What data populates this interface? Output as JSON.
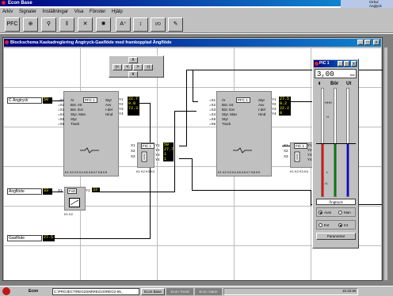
{
  "app": {
    "title": "Econ Base"
  },
  "corner_text": {
    "line1": "Cirkul",
    "line2": "Anglyck"
  },
  "menu": [
    "Arkiv",
    "Signaler",
    "Inställningar",
    "Visa",
    "Fönster",
    "Hjälp"
  ],
  "toolbar": [
    "PFC",
    "⊕",
    "⚲",
    "‖",
    "✕",
    "✺",
    "A⁺",
    "↕",
    "I/O",
    "✎"
  ],
  "window": {
    "title": "Blockschema Kaskadreglering Ångtryck-Gasflöde med framkopplad Ångflöde",
    "controls": [
      "_",
      "□",
      "X"
    ]
  },
  "nav": {
    "up": "∧",
    "down": "∨",
    "left": "<",
    "right": ">",
    "first": "|<",
    "last": ">|"
  },
  "inputs": {
    "angtryck": {
      "label": "C Ångtryck",
      "value": "50"
    },
    "angflode": {
      "label": "Ångflöde",
      "value": "33"
    },
    "gasflode": {
      "label": "Gasflöde",
      "value": "27.5"
    }
  },
  "pfc1": {
    "title": "PFC 1",
    "x_pins": [
      "X1",
      "X2",
      "X3",
      "X4",
      "X5"
    ],
    "x_names": [
      "Ár",
      "Bör. Int",
      "Bör. Ext",
      "Styr. Man",
      "Styr",
      "Track"
    ],
    "x_prefix": [
      "=X1",
      "=X2",
      "=X3",
      "=X4",
      "=X5",
      "=X6"
    ],
    "right_names": [
      "Styr",
      "Avv",
      "I-del",
      "Hind"
    ],
    "y_pins": [
      "Y1",
      "Y2",
      "Y3",
      "Y4"
    ],
    "y_values": [
      "22.7",
      "0.0",
      "72.3",
      ""
    ],
    "k_label": "K1 K2 K3 K4 K5 K6 K7 K8 K9"
  },
  "fic1_left": {
    "title": "FIC 1",
    "x_pins": [
      "X1",
      "X2",
      "X3"
    ],
    "y_pins": [
      "Y1",
      "Y2",
      "Y3",
      "Y4"
    ],
    "y_values": [
      "50",
      "27.7",
      "1",
      "1"
    ],
    "k_label": "K1 K2 K3 K4"
  },
  "pfc2": {
    "title": "PFC 1",
    "x_pins": [
      "X1",
      "X2",
      "X3",
      "X4",
      "X5"
    ],
    "x_names": [
      "Ár",
      "Bör. Int",
      "Bör. Ext",
      "Styr. Man",
      "Styr",
      "Track"
    ],
    "x_prefix": [
      "=X1",
      "=X2",
      "=X3",
      "=X4",
      "=X5",
      "=X6"
    ],
    "right_names": [
      "Styr",
      "Avv",
      "I-del",
      "Hind"
    ],
    "y_pins": [
      "Y1",
      "Y2",
      "Y3",
      "Y4"
    ],
    "y_values": [
      "27.5",
      "0.2",
      "22.2",
      "0"
    ],
    "k_label": "K1 K2 K3 K4 K5 K6 K7 K8 K9"
  },
  "fic1_right": {
    "title": "FIC 1",
    "x_pins": [
      "X1",
      "X2",
      "X3"
    ],
    "y_pins": [
      "Y1",
      "Y2",
      "Y3",
      "Y4"
    ],
    "k_label": "K1 K2 K3 K4"
  },
  "fxg": {
    "title": "FxG",
    "x_label": "X1",
    "y_label": "Y1",
    "y_value": "33",
    "k_label": "K1 K2"
  },
  "faceplate": {
    "title": "PIC 1",
    "controls": [
      "_",
      "□",
      "X"
    ],
    "value": "3,00",
    "unit": "bar",
    "col_bor": "Bör",
    "col_ut": "Ut",
    "scale_labels": [
      "HHH",
      "H",
      "L",
      "LL"
    ],
    "tag": "Ångtryck",
    "mode": {
      "auto": "Auto",
      "man": "Man"
    },
    "source": {
      "ext": "Ext",
      "int": "Int"
    },
    "param_button": "Parametrar",
    "colors": {
      "pv": "#ff0000",
      "sp": "#008000",
      "out": "#0000ff"
    }
  },
  "taskbar": {
    "start": "Econ",
    "path": "C:\\PROJECT\\REG2SIM\\REG2S\\REG2-55_",
    "tasks": [
      "Econ Base",
      "Econ Trend",
      "Econ Alarm"
    ],
    "clock": "15:32:55"
  }
}
